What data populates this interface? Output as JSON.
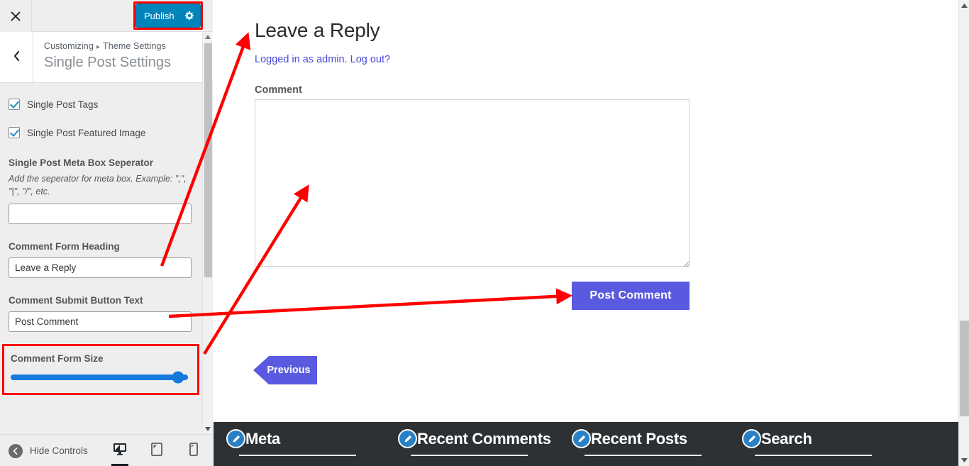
{
  "customizer": {
    "close_icon": "close-icon",
    "publish_label": "Publish",
    "publish_gear_icon": "gear-icon",
    "back_icon": "chevron-left-icon",
    "breadcrumb_root": "Customizing",
    "breadcrumb_separator": "▸",
    "breadcrumb_section": "Theme Settings",
    "panel_title": "Single Post Settings",
    "controls": {
      "checkbox_tags_label": "Single Post Tags",
      "checkbox_featured_label": "Single Post Featured Image",
      "separator_label": "Single Post Meta Box Seperator",
      "separator_description": "Add the seperator for meta box. Example: \",\", \"|\", \"/\", etc.",
      "separator_value": "",
      "separator_placeholder": "",
      "heading_label": "Comment Form Heading",
      "heading_value": "Leave a Reply",
      "submit_label": "Comment Submit Button Text",
      "submit_value": "Post Comment",
      "form_size_label": "Comment Form Size"
    },
    "footer": {
      "hide_controls_label": "Hide Controls",
      "hide_controls_icon": "collapse-arrow-icon",
      "device_desktop_icon": "desktop-icon",
      "device_tablet_icon": "tablet-icon",
      "device_mobile_icon": "mobile-icon"
    }
  },
  "preview": {
    "reply_heading": "Leave a Reply",
    "logged_in_prefix": "Logged in as admin. ",
    "logout_label": "Log out?",
    "comment_field_label": "Comment",
    "comment_value": "",
    "comment_placeholder": "",
    "post_comment_label": "Post Comment",
    "previous_label": "Previous",
    "footer_widgets": [
      {
        "title": "Meta",
        "edit_icon": "edit-pencil-icon"
      },
      {
        "title": "Recent Comments",
        "edit_icon": "edit-pencil-icon"
      },
      {
        "title": "Recent Posts",
        "edit_icon": "edit-pencil-icon"
      },
      {
        "title": "Search",
        "edit_icon": "edit-pencil-icon"
      }
    ]
  },
  "colors": {
    "publish_blue": "#0085ba",
    "annotation_red": "#ff0000",
    "slider_blue": "#1779e0",
    "button_purple": "#5a5ae0",
    "footer_dark": "#2e3133",
    "link_blue": "#4a4ad8",
    "edit_icon_blue": "#2980c4"
  }
}
